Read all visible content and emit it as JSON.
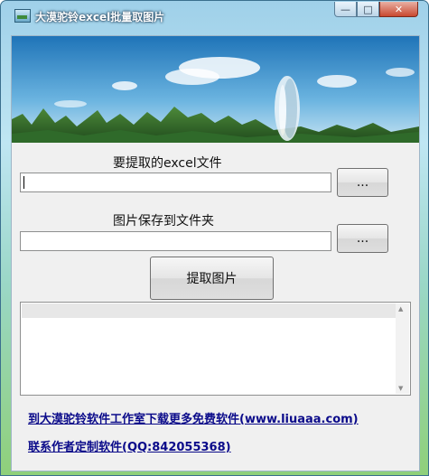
{
  "window": {
    "title": "大漠驼铃excel批量取图片",
    "controls": {
      "minimize": "—",
      "maximize": "□",
      "close": "✕"
    }
  },
  "excel": {
    "label": "要提取的excel文件",
    "value": "",
    "browse_label": "..."
  },
  "folder": {
    "label": "图片保存到文件夹",
    "value": "",
    "browse_label": "..."
  },
  "extract_button_label": "提取图片",
  "links": {
    "download": "到大漠驼铃软件工作室下载更多免费软件(www.liuaaa.com)",
    "contact": "联系作者定制软件(QQ:842055368)"
  },
  "colors": {
    "link": "#0b0b8a",
    "window_border": "#3a6f8e"
  },
  "icons": {
    "app": "app-icon",
    "scroll_up": "scroll-up-arrow-icon",
    "scroll_down": "scroll-down-arrow-icon"
  }
}
